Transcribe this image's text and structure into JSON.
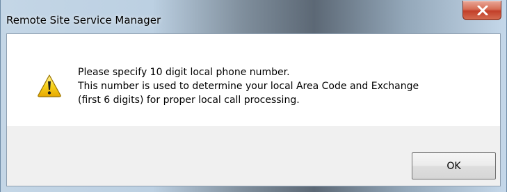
{
  "window": {
    "title": "Remote Site Service Manager"
  },
  "message": {
    "lines": [
      "Please specify 10 digit local phone number.",
      "This number is used to determine your local Area Code and Exchange",
      "(first 6 digits) for proper local call processing."
    ]
  },
  "buttons": {
    "ok_label": "OK"
  },
  "icons": {
    "message_icon": "warning-icon",
    "close": "close-icon"
  },
  "colors": {
    "close_button": "#c7432c",
    "warning_yellow": "#f5c400",
    "dialog_background": "#f0f0f0"
  }
}
